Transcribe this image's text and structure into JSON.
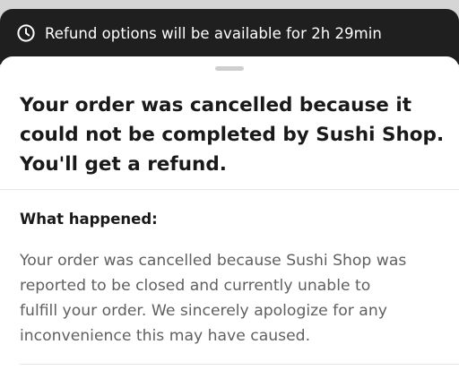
{
  "banner": {
    "icon": "clock-icon",
    "text": "Refund options will be available for 2h 29min"
  },
  "sheet": {
    "headline_lines": [
      "Your order was cancelled because it",
      "could not be completed by Sushi Shop.",
      "You'll get a refund."
    ],
    "section_title": "What happened:",
    "body_lines": [
      "Your order was cancelled because Sushi Shop was",
      "reported to be closed and currently unable to",
      "fulfill your order. We sincerely apologize for any",
      "inconvenience this may have caused."
    ]
  },
  "colors": {
    "banner_bg": "#1f1f1f",
    "text_primary": "#191919",
    "text_secondary": "#606060"
  }
}
